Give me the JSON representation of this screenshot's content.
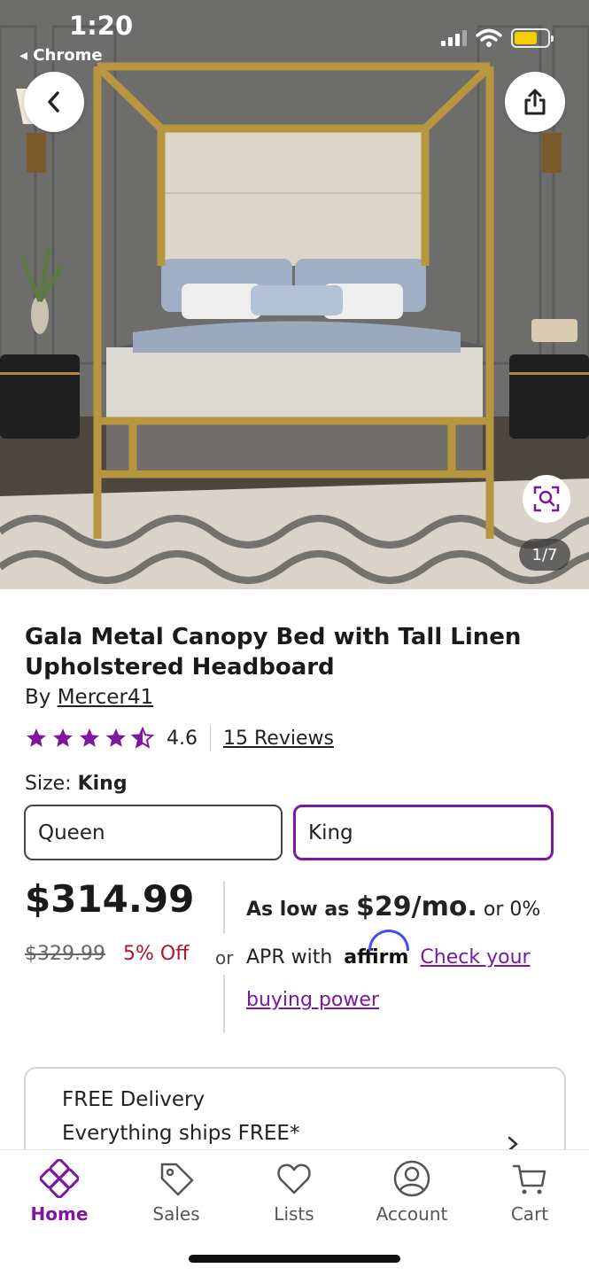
{
  "status_bar": {
    "time": "1:20",
    "back_app": "◂ Chrome"
  },
  "gallery": {
    "counter": "1/7"
  },
  "product": {
    "title": "Gala Metal Canopy Bed with Tall Linen Upholstered Headboard",
    "brand_prefix": "By ",
    "brand": "Mercer41",
    "rating": "4.6",
    "rating_stars": 4.5,
    "reviews": "15 Reviews"
  },
  "size": {
    "label": "Size: ",
    "selected": "King",
    "options": [
      "Queen",
      "King"
    ]
  },
  "pricing": {
    "price": "$314.99",
    "old_price": "$329.99",
    "discount": "5% Off",
    "or": "or"
  },
  "financing": {
    "prefix": "As low as ",
    "monthly": "$29/mo.",
    "middle": " or 0% APR with ",
    "provider": "affirm",
    "link": "Check your buying power"
  },
  "delivery": {
    "line1": "FREE Delivery",
    "line2": "Everything ships FREE*"
  },
  "nav": {
    "home": "Home",
    "sales": "Sales",
    "lists": "Lists",
    "account": "Account",
    "cart": "Cart"
  },
  "colors": {
    "accent_purple": "#7b189f",
    "discount_red": "#b3122c",
    "battery_yellow": "#f5d000",
    "affirm_blue": "#4a4af4"
  }
}
